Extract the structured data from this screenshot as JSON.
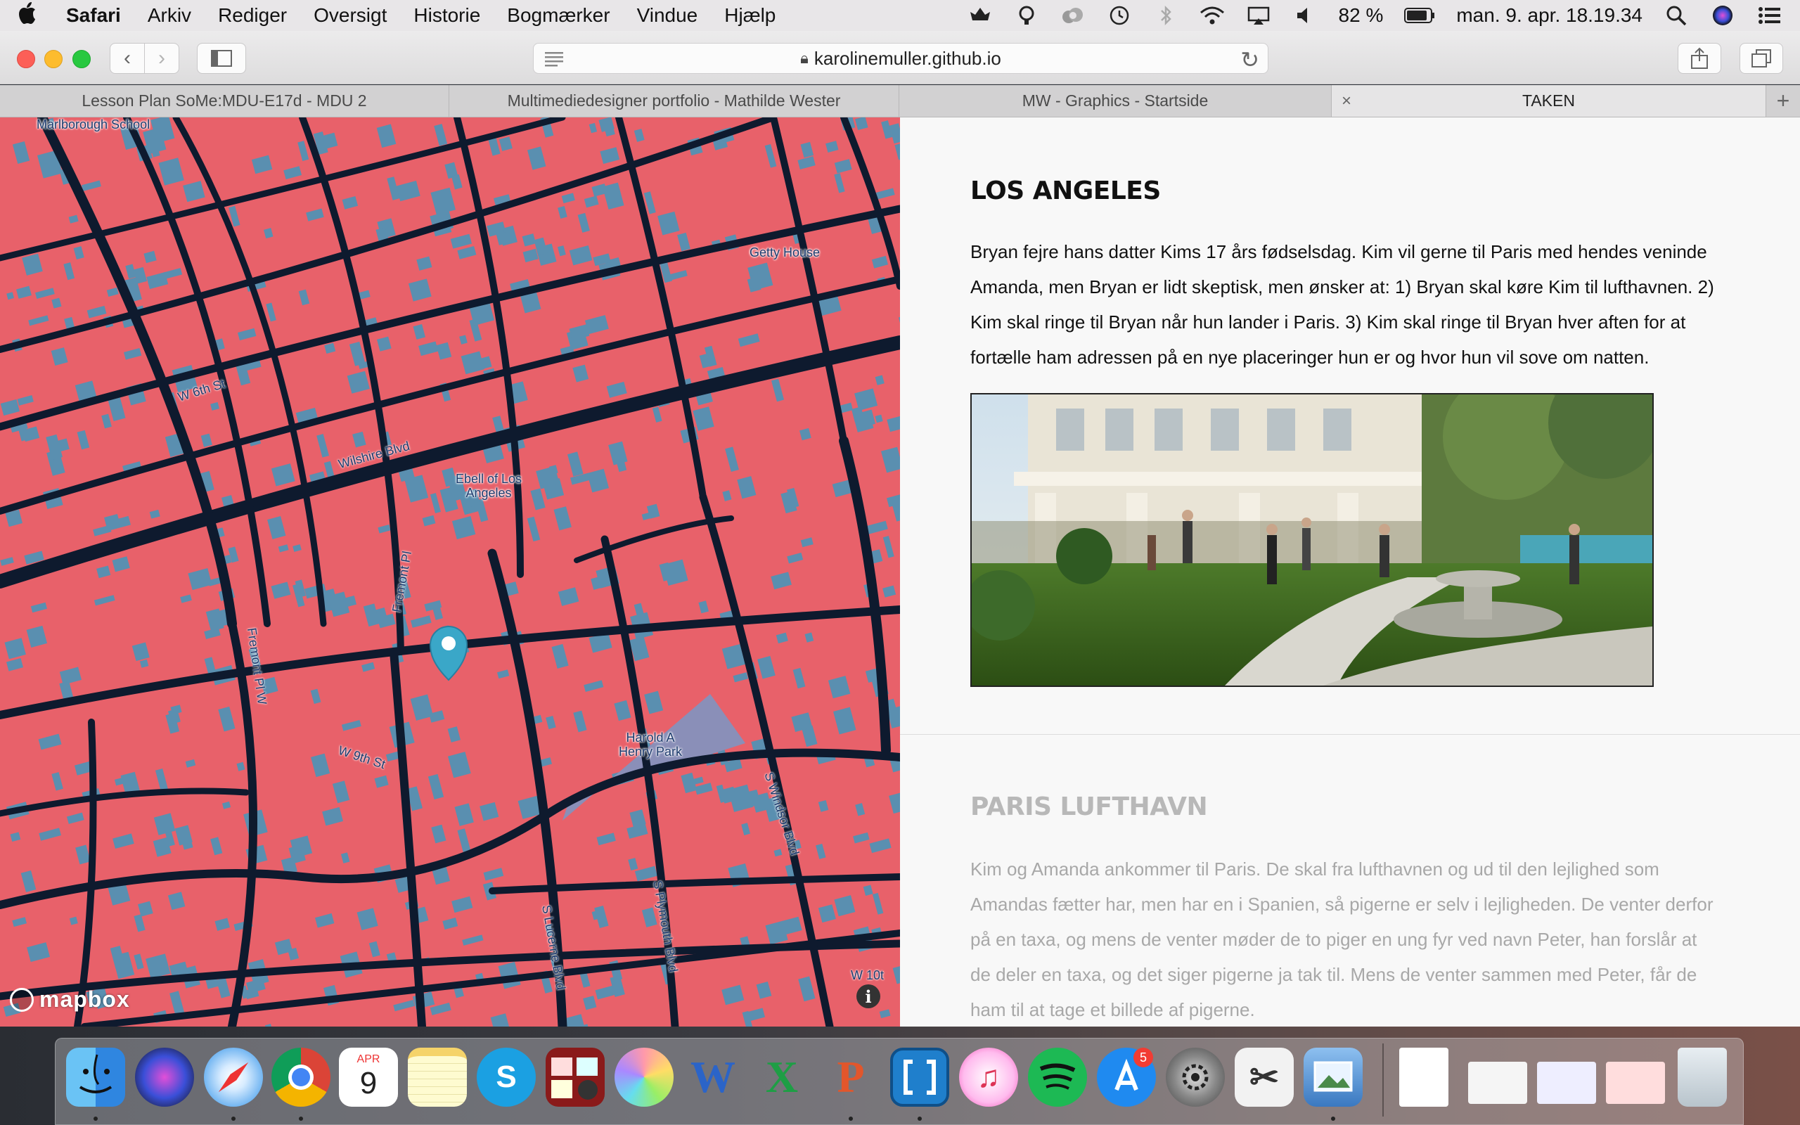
{
  "menubar": {
    "app_name": "Safari",
    "items": [
      "Arkiv",
      "Rediger",
      "Oversigt",
      "Historie",
      "Bogmærker",
      "Vindue",
      "Hjælp"
    ],
    "battery": "82 %",
    "clock": "man. 9. apr. 18.19.34",
    "status_icons": [
      "creative-cloud-icon",
      "location-icon",
      "cloud-icon",
      "time-machine-icon",
      "bluetooth-icon",
      "wifi-icon",
      "airplay-icon",
      "volume-icon",
      "battery-icon",
      "spotlight-icon",
      "siri-icon",
      "notification-center-icon"
    ]
  },
  "toolbar": {
    "address": "karolinemuller.github.io"
  },
  "tabs": [
    {
      "label": "Lesson Plan SoMe:MDU-E17d - MDU 2",
      "active": false
    },
    {
      "label": "Multimediedesigner portfolio - Mathilde Wester",
      "active": false
    },
    {
      "label": "MW - Graphics - Startside",
      "active": false
    },
    {
      "label": "TAKEN",
      "active": true
    }
  ],
  "map": {
    "colors": {
      "land": "#e8616a",
      "buildings": "#5a8fb0",
      "roads": "#0e1a2e",
      "park": "#8a8fb8",
      "marker": "#3aa7c8"
    },
    "labels": {
      "marlborough_school": "Marlborough School",
      "getty_house": "Getty House",
      "ebell": "Ebell of Los Angeles",
      "harold_park": "Harold A Henry Park"
    },
    "streets": {
      "w6th": "W 6th St",
      "wilshire": "Wilshire Blvd",
      "fremont_pl": "Fremont Pl",
      "fremont_plw": "Fremont Pl W",
      "w9th": "W 9th St",
      "lucerne": "S Lucerne Blvd",
      "plymouth": "S Plymouth Blvd",
      "windsor": "S Windsor Blvd",
      "w10th": "W 10t"
    },
    "attribution": "mapbox",
    "info": "i"
  },
  "content": {
    "la_title": "LOS ANGELES",
    "la_body": "Bryan fejre hans datter Kims 17 års fødselsdag. Kim vil gerne til Paris med hendes veninde Amanda, men Bryan er lidt skeptisk, men ønsker at: 1) Bryan skal køre Kim til lufthavnen. 2) Kim skal ringe til Bryan når hun lander i Paris. 3) Kim skal ringe til Bryan hver aften for at fortælle ham adressen på en nye placeringer hun er og hvor hun vil sove om natten.",
    "paris_title": "PARIS LUFTHAVN",
    "paris_body": "Kim og Amanda ankommer til Paris. De skal fra lufthavnen og ud til den lejlighed som Amandas fætter har, men har en i Spanien, så pigerne er selv i lejligheden. De venter derfor på en taxa, og mens de venter møder de to piger en ung fyr ved navn Peter, han forslår at de deler en taxa, og det siger pigerne ja tak til. Mens de venter sammen med Peter, får de ham til at tage et billede af pigerne."
  },
  "dock": {
    "calendar_month": "APR",
    "calendar_day": "9",
    "appstore_badge": "5",
    "apps": [
      "finder-icon",
      "siri-app-icon",
      "safari-icon",
      "chrome-icon",
      "calendar-icon",
      "notes-icon",
      "skype-icon",
      "photo-booth-icon",
      "photos-icon",
      "word-icon",
      "excel-icon",
      "powerpoint-icon",
      "brackets-icon",
      "itunes-icon",
      "spotify-icon",
      "app-store-icon",
      "system-preferences-icon",
      "scissors-icon",
      "preview-icon"
    ],
    "docs": [
      "doc-thumbnail-1",
      "doc-thumbnail-2",
      "doc-thumbnail-3",
      "doc-thumbnail-4"
    ],
    "trash": "trash-icon"
  }
}
